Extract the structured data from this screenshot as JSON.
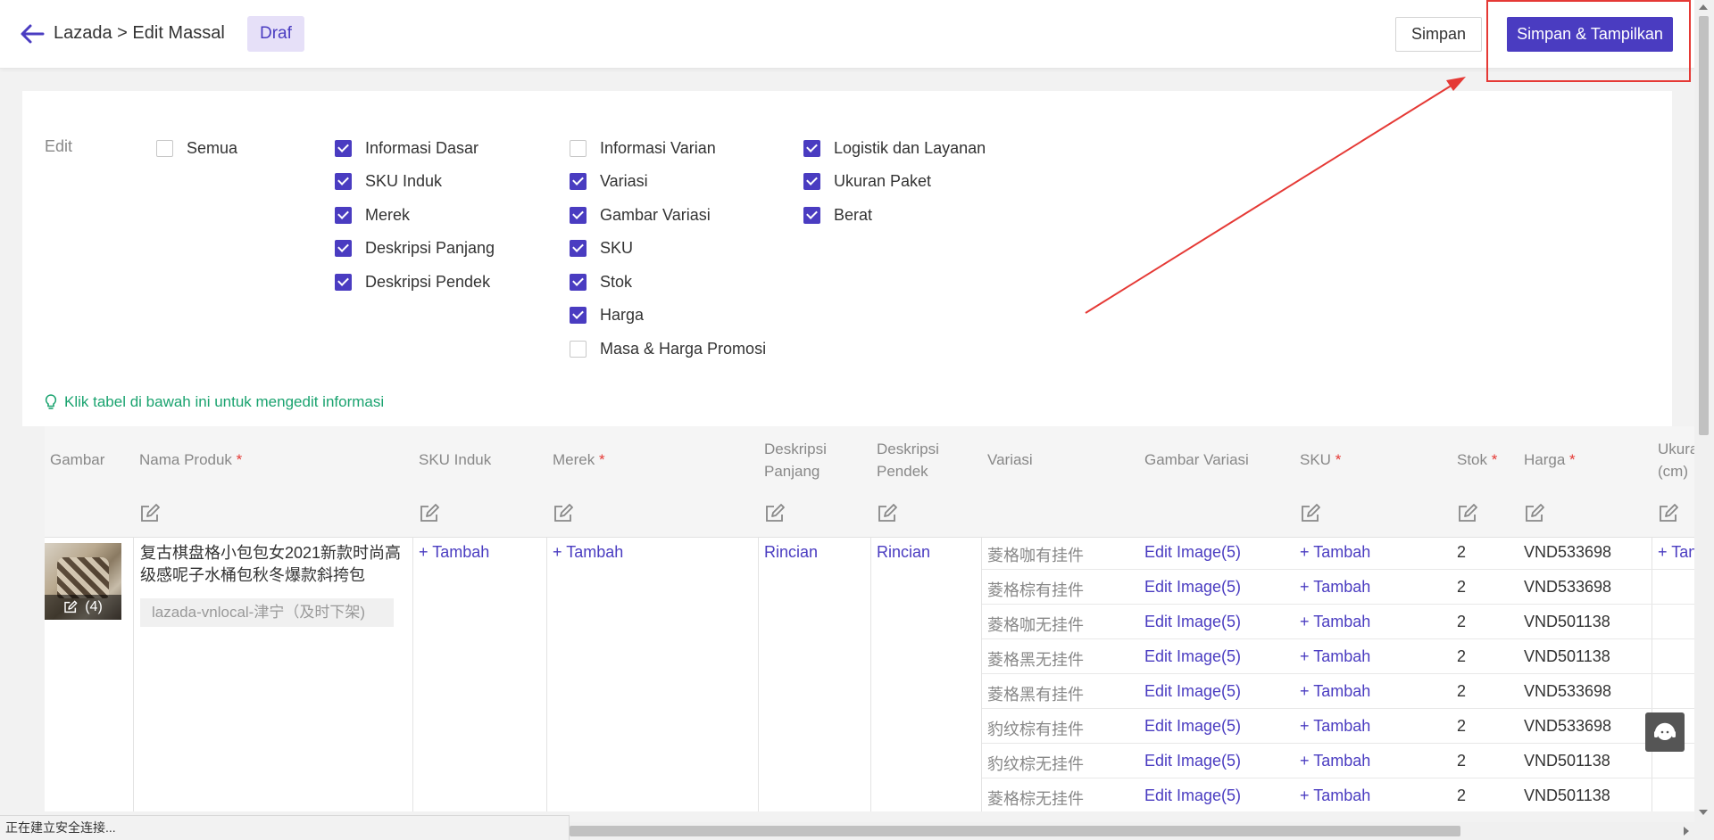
{
  "header": {
    "breadcrumb": "Lazada > Edit Massal",
    "status_badge": "Draf",
    "save_label": "Simpan",
    "save_publish_label": "Simpan & Tampilkan"
  },
  "edit_panel": {
    "label": "Edit",
    "groups": [
      {
        "items": [
          {
            "label": "Semua",
            "checked": false
          }
        ]
      },
      {
        "items": [
          {
            "label": "Informasi Dasar",
            "checked": true
          },
          {
            "label": "SKU Induk",
            "checked": true
          },
          {
            "label": "Merek",
            "checked": true
          },
          {
            "label": "Deskripsi Panjang",
            "checked": true
          },
          {
            "label": "Deskripsi Pendek",
            "checked": true
          }
        ]
      },
      {
        "items": [
          {
            "label": "Informasi Varian",
            "checked": false
          },
          {
            "label": "Variasi",
            "checked": true
          },
          {
            "label": "Gambar Variasi",
            "checked": true
          },
          {
            "label": "SKU",
            "checked": true
          },
          {
            "label": "Stok",
            "checked": true
          },
          {
            "label": "Harga",
            "checked": true
          },
          {
            "label": "Masa & Harga Promosi",
            "checked": false
          }
        ]
      },
      {
        "items": [
          {
            "label": "Logistik dan Layanan",
            "checked": true
          },
          {
            "label": "Ukuran Paket",
            "checked": true
          },
          {
            "label": "Berat",
            "checked": true
          }
        ]
      }
    ],
    "hint": "Klik tabel di bawah ini untuk mengedit informasi"
  },
  "table": {
    "columns": {
      "gambar": "Gambar",
      "nama_produk": "Nama Produk",
      "sku_induk": "SKU Induk",
      "merek": "Merek",
      "deskripsi_panjang_1": "Deskripsi",
      "deskripsi_panjang_2": "Panjang",
      "deskripsi_pendek_1": "Deskripsi",
      "deskripsi_pendek_2": "Pendek",
      "variasi": "Variasi",
      "gambar_variasi": "Gambar Variasi",
      "sku": "SKU",
      "stok": "Stok",
      "harga": "Harga",
      "ukuran_1": "Ukura",
      "ukuran_2": "(cm)",
      "required_mark": "*"
    },
    "product": {
      "image_count": "(4)",
      "name": "复古棋盘格小包包女2021新款时尚高级感呢子水桶包秋冬爆款斜挎包",
      "shop": "lazada-vnlocal-津宁（及时下架)",
      "sku_induk": "+ Tambah",
      "merek": "+ Tambah",
      "deskripsi_panjang": "Rincian",
      "deskripsi_pendek": "Rincian",
      "ukuran": "+ Tan"
    },
    "variants": [
      {
        "variasi": "菱格咖有挂件",
        "gambar": "Edit Image(5)",
        "sku": "+ Tambah",
        "stok": "2",
        "harga": "VND533698"
      },
      {
        "variasi": "菱格棕有挂件",
        "gambar": "Edit Image(5)",
        "sku": "+ Tambah",
        "stok": "2",
        "harga": "VND533698"
      },
      {
        "variasi": "菱格咖无挂件",
        "gambar": "Edit Image(5)",
        "sku": "+ Tambah",
        "stok": "2",
        "harga": "VND501138"
      },
      {
        "variasi": "菱格黑无挂件",
        "gambar": "Edit Image(5)",
        "sku": "+ Tambah",
        "stok": "2",
        "harga": "VND501138"
      },
      {
        "variasi": "菱格黑有挂件",
        "gambar": "Edit Image(5)",
        "sku": "+ Tambah",
        "stok": "2",
        "harga": "VND533698"
      },
      {
        "variasi": "豹纹棕有挂件",
        "gambar": "Edit Image(5)",
        "sku": "+ Tambah",
        "stok": "2",
        "harga": "VND533698"
      },
      {
        "variasi": "豹纹棕无挂件",
        "gambar": "Edit Image(5)",
        "sku": "+ Tambah",
        "stok": "2",
        "harga": "VND501138"
      },
      {
        "variasi": "菱格棕无挂件",
        "gambar": "Edit Image(5)",
        "sku": "+ Tambah",
        "stok": "2",
        "harga": "VND501138"
      }
    ]
  },
  "status_bar": "正在建立安全连接...",
  "colors": {
    "accent": "#4a3cc1",
    "hint": "#1aa36f",
    "annotation": "#e53935"
  }
}
